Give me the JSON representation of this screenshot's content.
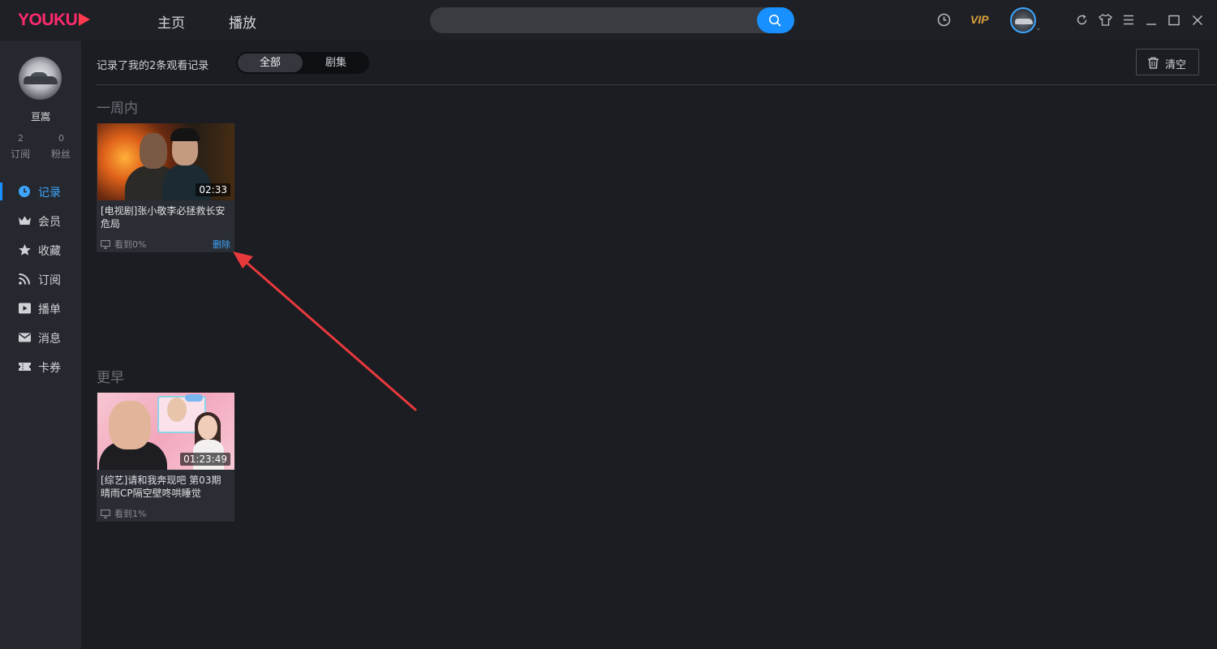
{
  "app": {
    "logo": "YOUKU"
  },
  "nav": {
    "home": "主页",
    "play": "播放"
  },
  "search": {
    "placeholder": ""
  },
  "toolbar": {
    "vip": "VIP"
  },
  "sidebar": {
    "username": "亘嵩",
    "stats": [
      {
        "num": "2",
        "label": "订阅"
      },
      {
        "num": "0",
        "label": "粉丝"
      }
    ],
    "menu": [
      {
        "label": "记录",
        "icon": "clock-icon",
        "active": true
      },
      {
        "label": "会员",
        "icon": "crown-icon"
      },
      {
        "label": "收藏",
        "icon": "star-icon"
      },
      {
        "label": "订阅",
        "icon": "rss-icon"
      },
      {
        "label": "播单",
        "icon": "playlist-icon"
      },
      {
        "label": "消息",
        "icon": "mail-icon"
      },
      {
        "label": "卡券",
        "icon": "ticket-icon"
      }
    ]
  },
  "main": {
    "summary": "记录了我的2条观看记录",
    "filters": {
      "all": "全部",
      "series": "剧集"
    },
    "clear_label": "清空",
    "sections": [
      {
        "title": "一周内",
        "items": [
          {
            "title": "[电视剧]张小敬李必拯救长安危局",
            "duration": "02:33",
            "progress": "看到0%",
            "delete": "删除"
          }
        ]
      },
      {
        "title": "更早",
        "items": [
          {
            "title": "[综艺]请和我奔现吧 第03期 晴雨CP隔空壁咚哄睡觉",
            "duration": "01:23:49",
            "progress": "看到1%"
          }
        ]
      }
    ]
  },
  "colors": {
    "accent": "#1890ff",
    "vip": "#d9a13a",
    "logo": "#ff2a6d",
    "annotation_arrow": "#e8393b"
  }
}
